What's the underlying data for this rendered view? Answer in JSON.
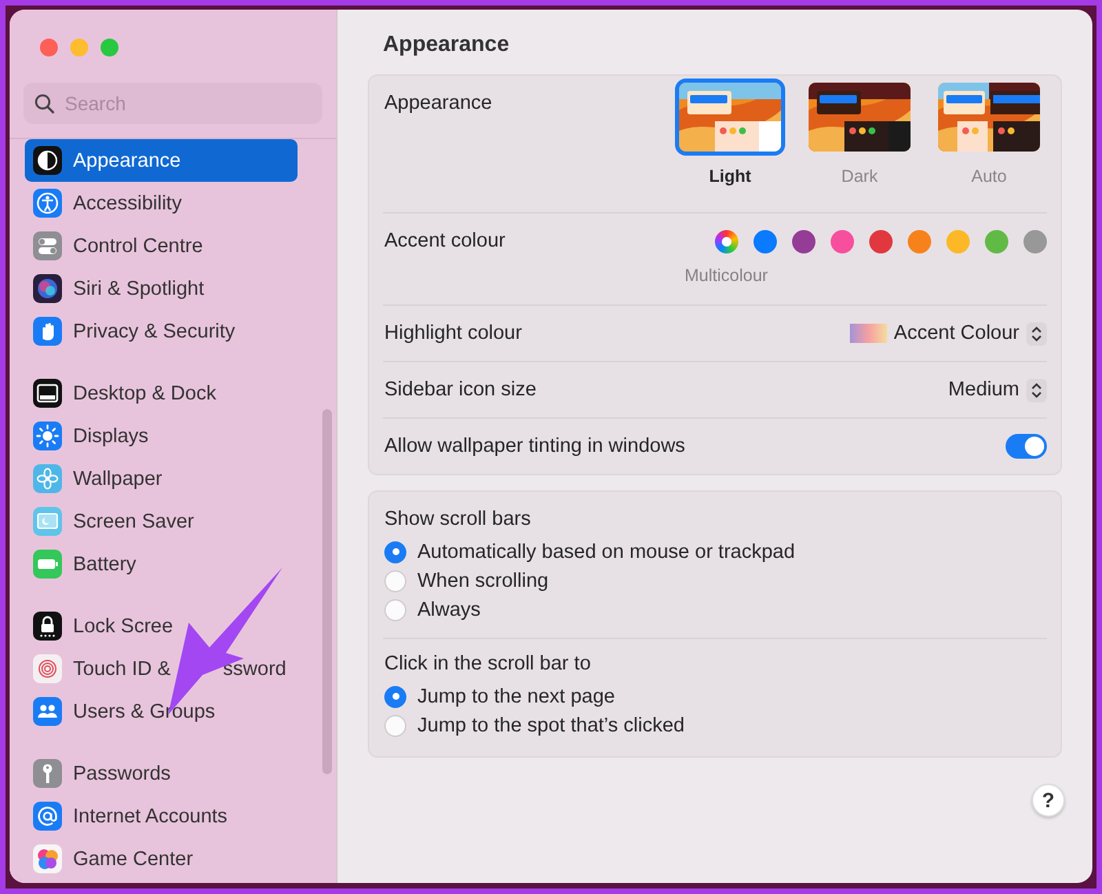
{
  "window": {
    "title": "Appearance"
  },
  "sidebar": {
    "search": {
      "placeholder": "Search"
    },
    "groups": [
      {
        "items": [
          {
            "label": "Appearance",
            "selected": true
          },
          {
            "label": "Accessibility",
            "selected": false
          },
          {
            "label": "Control Centre",
            "selected": false
          },
          {
            "label": "Siri & Spotlight",
            "selected": false
          },
          {
            "label": "Privacy & Security",
            "selected": false
          }
        ]
      },
      {
        "items": [
          {
            "label": "Desktop & Dock",
            "selected": false
          },
          {
            "label": "Displays",
            "selected": false
          },
          {
            "label": "Wallpaper",
            "selected": false
          },
          {
            "label": "Screen Saver",
            "selected": false
          },
          {
            "label": "Battery",
            "selected": false
          }
        ]
      },
      {
        "items": [
          {
            "label": "Lock Scree",
            "selected": false
          },
          {
            "label": "Touch ID &",
            "label_after_arrow": "ssword",
            "selected": false
          },
          {
            "label": "Users & Groups",
            "selected": false
          }
        ]
      },
      {
        "items": [
          {
            "label": "Passwords",
            "selected": false
          },
          {
            "label": "Internet Accounts",
            "selected": false
          },
          {
            "label": "Game Center",
            "selected": false
          }
        ]
      }
    ]
  },
  "annotation": {
    "kind": "arrow"
  },
  "settings": {
    "label": "Appearance",
    "options": [
      {
        "label": "Light",
        "kind": "light",
        "selected": true
      },
      {
        "label": "Dark",
        "kind": "dark",
        "selected": false
      },
      {
        "label": "Auto",
        "kind": "auto",
        "selected": false
      }
    ]
  },
  "accent": {
    "label": "Accent colour",
    "selected_name": "Multicolour",
    "colors": [
      {
        "kind": "multi",
        "selected": true
      },
      {
        "kind": "solid",
        "color": "#0a7aff",
        "selected": false
      },
      {
        "kind": "solid",
        "color": "#953d96",
        "selected": false
      },
      {
        "kind": "solid",
        "color": "#f74f9e",
        "selected": false
      },
      {
        "kind": "solid",
        "color": "#e0383e",
        "selected": false
      },
      {
        "kind": "solid",
        "color": "#f7821b",
        "selected": false
      },
      {
        "kind": "solid",
        "color": "#fcb827",
        "selected": false
      },
      {
        "kind": "solid",
        "color": "#62ba46",
        "selected": false
      },
      {
        "kind": "solid",
        "color": "#989898",
        "selected": false
      }
    ]
  },
  "highlight": {
    "label": "Highlight colour",
    "value": "Accent Colour"
  },
  "icon_size": {
    "label": "Sidebar icon size",
    "value": "Medium"
  },
  "tinting": {
    "label": "Allow wallpaper tinting in windows",
    "on": true
  },
  "radio_groups": [
    {
      "label": "Show scroll bars",
      "options": [
        {
          "label": "Automatically based on mouse or trackpad",
          "selected": true
        },
        {
          "label": "When scrolling",
          "selected": false
        },
        {
          "label": "Always",
          "selected": false
        }
      ]
    },
    {
      "label": "Click in the scroll bar to",
      "options": [
        {
          "label": "Jump to the next page",
          "selected": true
        },
        {
          "label": "Jump to the spot that’s clicked",
          "selected": false
        }
      ]
    }
  ],
  "help": {
    "label": "?"
  }
}
